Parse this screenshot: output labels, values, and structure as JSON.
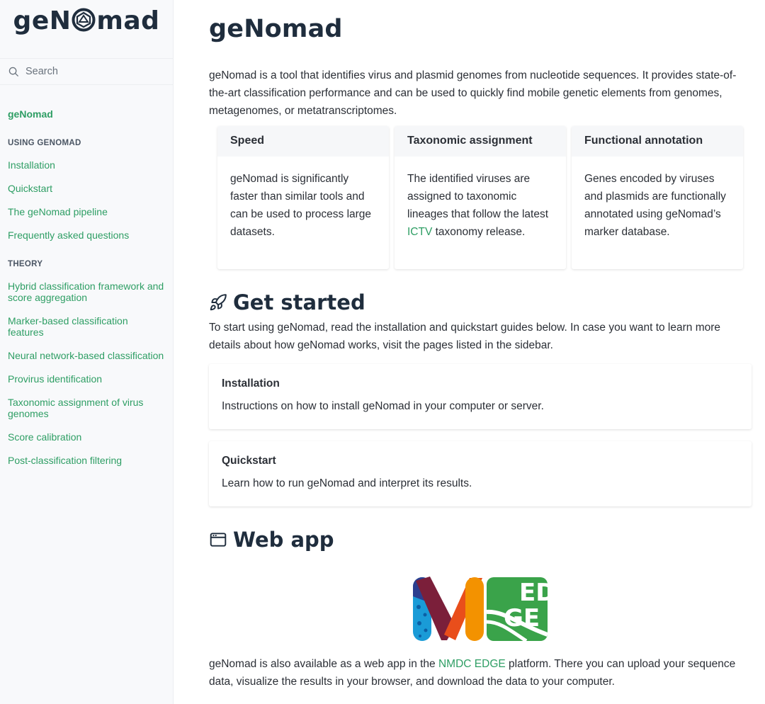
{
  "sidebar": {
    "brand_left": "geN",
    "brand_right": "mad",
    "search_placeholder": "Search",
    "home_link": "geNomad",
    "sections": [
      {
        "title": "USING GENOMAD",
        "items": [
          "Installation",
          "Quickstart",
          "The geNomad pipeline",
          "Frequently asked questions"
        ]
      },
      {
        "title": "THEORY",
        "items": [
          "Hybrid classification framework and score aggregation",
          "Marker-based classification features",
          "Neural network-based classification",
          "Provirus identification",
          "Taxonomic assignment of virus genomes",
          "Score calibration",
          "Post-classification filtering"
        ]
      }
    ]
  },
  "main": {
    "title": "geNomad",
    "intro": "geNomad is a tool that identifies virus and plasmid genomes from nucleotide sequences. It provides state-of-the-art classification performance and can be used to quickly find mobile genetic elements from genomes, metagenomes, or metatranscriptomes.",
    "cards": [
      {
        "title": "Speed",
        "body": "geNomad is significantly faster than similar tools and can be used to process large datasets."
      },
      {
        "title": "Taxonomic assignment",
        "body_before": "The identified viruses are assigned to taxonomic lineages that follow the latest ",
        "link": "ICTV",
        "body_after": " taxonomy release."
      },
      {
        "title": "Functional annotation",
        "body": "Genes encoded by viruses and plasmids are functionally annotated using geNomad’s marker database."
      }
    ],
    "get_started": {
      "title": "Get started",
      "text": "To start using geNomad, read the installation and quickstart guides below. In case you want to learn more details about how geNomad works, visit the pages listed in the sidebar.",
      "links": [
        {
          "title": "Installation",
          "desc": "Instructions on how to install geNomad in your computer or server."
        },
        {
          "title": "Quickstart",
          "desc": "Learn how to run geNomad and interpret its results."
        }
      ]
    },
    "web_app": {
      "title": "Web app",
      "logo_letters_top": "ED",
      "logo_letters_bottom": "GE",
      "text_before": "geNomad is also available as a web app in the ",
      "link": "NMDC EDGE",
      "text_after": " platform. There you can upload your sequence data, visualize the results in your browser, and download the data to your computer."
    }
  },
  "colors": {
    "accent_green": "#2e9e64",
    "heading": "#1f2d3d",
    "sidebar_bg": "#f8f9fb"
  }
}
